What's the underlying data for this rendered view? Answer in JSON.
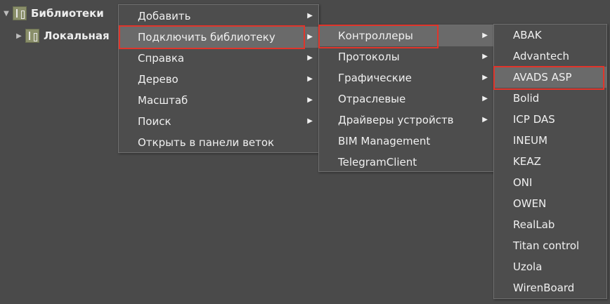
{
  "tree": {
    "root_label": "Библиотеки",
    "child_label": "Локальная"
  },
  "menu1": {
    "items": [
      {
        "label": "Добавить",
        "submenu": true
      },
      {
        "label": "Подключить библиотеку",
        "submenu": true
      },
      {
        "label": "Справка",
        "submenu": true
      },
      {
        "label": "Дерево",
        "submenu": true
      },
      {
        "label": "Масштаб",
        "submenu": true
      },
      {
        "label": "Поиск",
        "submenu": true
      },
      {
        "label": "Открыть в панели веток",
        "submenu": false
      }
    ]
  },
  "menu2": {
    "items": [
      {
        "label": "Контроллеры",
        "submenu": true
      },
      {
        "label": "Протоколы",
        "submenu": true
      },
      {
        "label": "Графические",
        "submenu": true
      },
      {
        "label": "Отраслевые",
        "submenu": true
      },
      {
        "label": "Драйверы устройств",
        "submenu": true
      },
      {
        "label": "BIM Management",
        "submenu": false
      },
      {
        "label": "TelegramClient",
        "submenu": false
      }
    ]
  },
  "menu3": {
    "items": [
      {
        "label": "ABAK"
      },
      {
        "label": "Advantech"
      },
      {
        "label": "AVADS ASP"
      },
      {
        "label": "Bolid"
      },
      {
        "label": "ICP DAS"
      },
      {
        "label": "INEUM"
      },
      {
        "label": "KEAZ"
      },
      {
        "label": "ONI"
      },
      {
        "label": "OWEN"
      },
      {
        "label": "RealLab"
      },
      {
        "label": "Titan control"
      },
      {
        "label": "Uzola"
      },
      {
        "label": "WirenBoard"
      }
    ]
  },
  "colors": {
    "background": "#4a4a4a",
    "menu_background": "#4d4d4d",
    "hover": "#6a6a6a",
    "highlight_border": "#e0352b"
  }
}
